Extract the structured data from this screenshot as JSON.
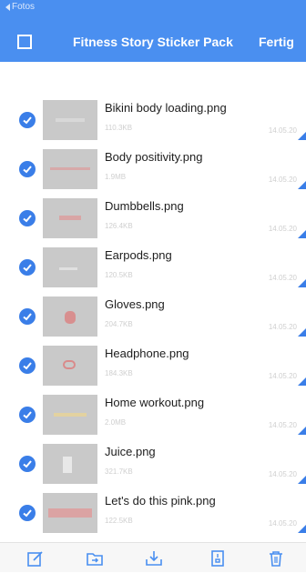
{
  "header": {
    "back_label": "Fotos",
    "title": "Fitness Story Sticker Pack",
    "done_label": "Fertig"
  },
  "colors": {
    "accent": "#4a8ff0",
    "check": "#3a7ee8",
    "thumbnail": "#c9c9c9",
    "meta_text": "#cfcfcf"
  },
  "files": [
    {
      "name": "Bikini body loading.png",
      "size": "110.3KB",
      "date": "14.05.20",
      "selected": true
    },
    {
      "name": "Body positivity.png",
      "size": "1.9MB",
      "date": "14.05.20",
      "selected": true
    },
    {
      "name": "Dumbbells.png",
      "size": "126.4KB",
      "date": "14.05.20",
      "selected": true
    },
    {
      "name": "Earpods.png",
      "size": "120.5KB",
      "date": "14.05.20",
      "selected": true
    },
    {
      "name": "Gloves.png",
      "size": "204.7KB",
      "date": "14.05.20",
      "selected": true
    },
    {
      "name": "Headphone.png",
      "size": "184.3KB",
      "date": "14.05.20",
      "selected": true
    },
    {
      "name": "Home workout.png",
      "size": "2.0MB",
      "date": "14.05.20",
      "selected": true
    },
    {
      "name": "Juice.png",
      "size": "321.7KB",
      "date": "14.05.20",
      "selected": true
    },
    {
      "name": "Let's do this pink.png",
      "size": "122.5KB",
      "date": "14.05.20",
      "selected": true
    }
  ],
  "toolbar": {
    "icons": [
      "edit-icon",
      "move-to-folder-icon",
      "download-icon",
      "archive-icon",
      "delete-icon"
    ]
  }
}
